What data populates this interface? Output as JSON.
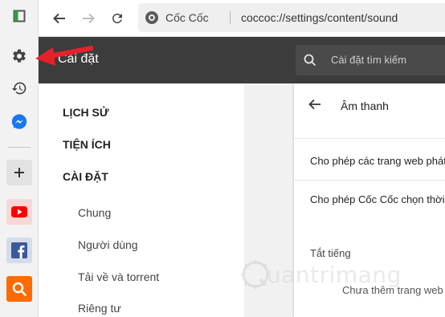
{
  "toolbar": {
    "brand": "Cốc Cốc",
    "url": "coccoc://settings/content/sound"
  },
  "settings": {
    "title": "Cài đặt",
    "search_placeholder": "Cài đặt tìm kiếm"
  },
  "nav": {
    "sections": [
      "LỊCH SỬ",
      "TIỆN ÍCH",
      "CÀI ĐẶT"
    ],
    "items": [
      "Chung",
      "Người dùng",
      "Tải về và torrent",
      "Riêng tư"
    ]
  },
  "content": {
    "title": "Âm thanh",
    "rows": [
      "Cho phép các trang web phát",
      "Cho phép Cốc Cốc chọn thời"
    ],
    "mute_label": "Tắt tiếng",
    "mute_empty": "Chưa thêm trang web"
  },
  "watermark": {
    "text": "uantrimang"
  },
  "colors": {
    "header_bg": "#3c3c3c",
    "annotation": "#e8202a",
    "messenger": "#1877f2",
    "youtube": "#ff0000",
    "facebook": "#3b5998",
    "search_tile": "#ff6b00"
  }
}
